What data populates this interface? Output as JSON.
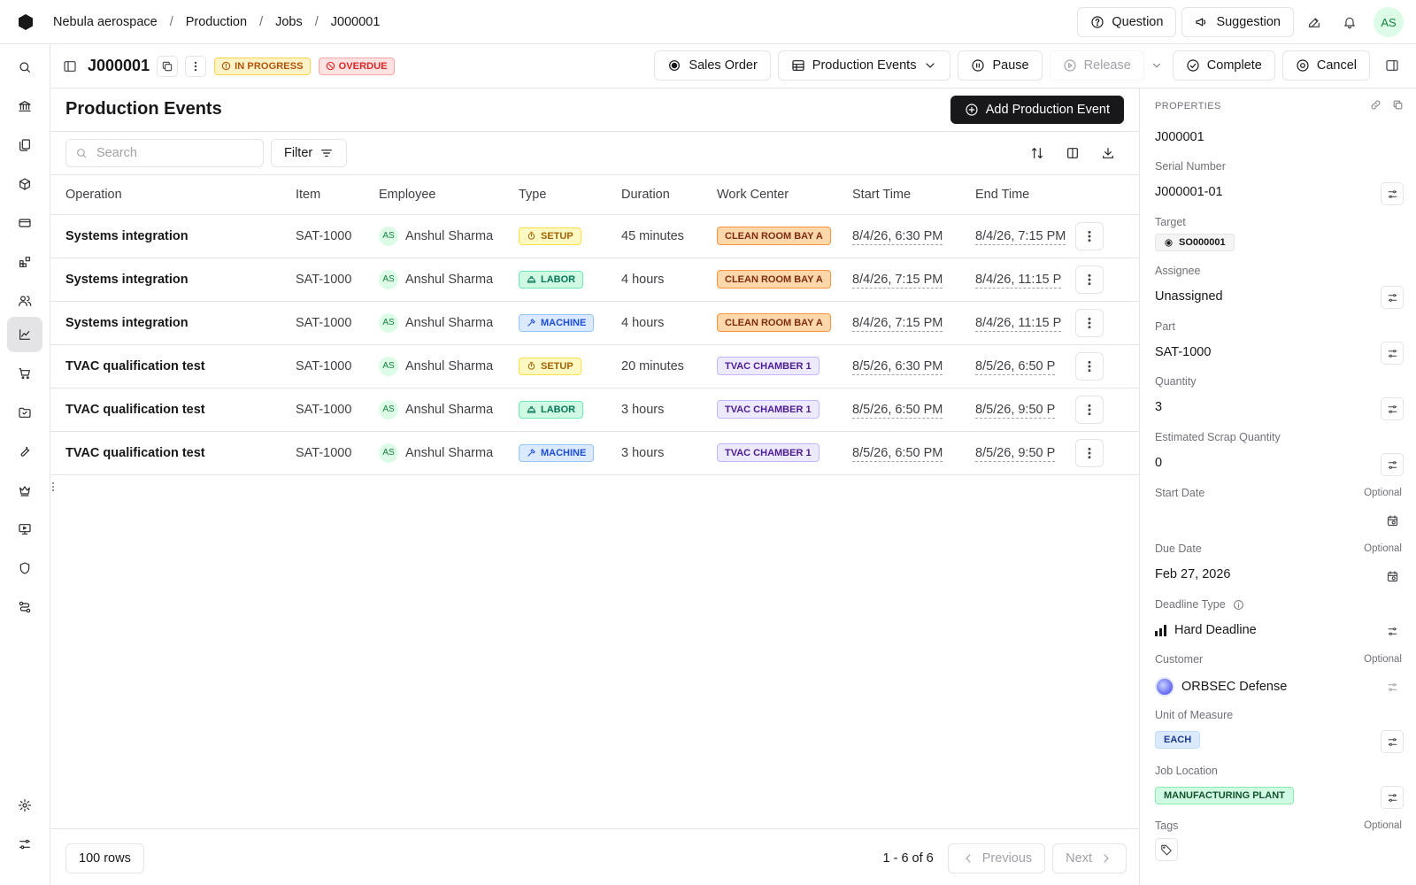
{
  "breadcrumbs": [
    "Nebula aerospace",
    "Production",
    "Jobs",
    "J000001"
  ],
  "top_actions": {
    "question": "Question",
    "suggestion": "Suggestion",
    "user_initials": "AS"
  },
  "job": {
    "id": "J000001",
    "status_badges": [
      {
        "label": "IN PROGRESS",
        "color": "#b45309"
      },
      {
        "label": "OVERDUE",
        "color": "#dc2626"
      }
    ],
    "actions": {
      "sales_order": "Sales Order",
      "production_events": "Production Events",
      "pause": "Pause",
      "release": "Release",
      "complete": "Complete",
      "cancel": "Cancel"
    }
  },
  "main": {
    "title": "Production Events",
    "add_button": "Add Production Event",
    "search_placeholder": "Search",
    "filter_label": "Filter",
    "columns": [
      "Operation",
      "Item",
      "Employee",
      "Type",
      "Duration",
      "Work Center",
      "Start Time",
      "End Time"
    ],
    "rows": [
      {
        "operation": "Systems integration",
        "item": "SAT-1000",
        "employee_initials": "AS",
        "employee": "Anshul Sharma",
        "type": "SETUP",
        "duration": "45 minutes",
        "work_center": "CLEAN ROOM BAY A",
        "start": "8/4/26, 6:30 PM",
        "end": "8/4/26, 7:15 PM"
      },
      {
        "operation": "Systems integration",
        "item": "SAT-1000",
        "employee_initials": "AS",
        "employee": "Anshul Sharma",
        "type": "LABOR",
        "duration": "4 hours",
        "work_center": "CLEAN ROOM BAY A",
        "start": "8/4/26, 7:15 PM",
        "end": "8/4/26, 11:15 P"
      },
      {
        "operation": "Systems integration",
        "item": "SAT-1000",
        "employee_initials": "AS",
        "employee": "Anshul Sharma",
        "type": "MACHINE",
        "duration": "4 hours",
        "work_center": "CLEAN ROOM BAY A",
        "start": "8/4/26, 7:15 PM",
        "end": "8/4/26, 11:15 P"
      },
      {
        "operation": "TVAC qualification test",
        "item": "SAT-1000",
        "employee_initials": "AS",
        "employee": "Anshul Sharma",
        "type": "SETUP",
        "duration": "20 minutes",
        "work_center": "TVAC CHAMBER 1",
        "start": "8/5/26, 6:30 PM",
        "end": "8/5/26, 6:50 P"
      },
      {
        "operation": "TVAC qualification test",
        "item": "SAT-1000",
        "employee_initials": "AS",
        "employee": "Anshul Sharma",
        "type": "LABOR",
        "duration": "3 hours",
        "work_center": "TVAC CHAMBER 1",
        "start": "8/5/26, 6:50 PM",
        "end": "8/5/26, 9:50 P"
      },
      {
        "operation": "TVAC qualification test",
        "item": "SAT-1000",
        "employee_initials": "AS",
        "employee": "Anshul Sharma",
        "type": "MACHINE",
        "duration": "3 hours",
        "work_center": "TVAC CHAMBER 1",
        "start": "8/5/26, 6:50 PM",
        "end": "8/5/26, 9:50 P"
      }
    ],
    "rows_per_page": "100 rows",
    "pagination_count": "1 - 6 of 6",
    "previous": "Previous",
    "next": "Next"
  },
  "properties": {
    "heading": "PROPERTIES",
    "job_id": "J000001",
    "serial_number_label": "Serial Number",
    "serial_number": "J000001-01",
    "target_label": "Target",
    "target": "SO000001",
    "assignee_label": "Assignee",
    "assignee": "Unassigned",
    "part_label": "Part",
    "part": "SAT-1000",
    "quantity_label": "Quantity",
    "quantity": "3",
    "scrap_label": "Estimated Scrap Quantity",
    "scrap": "0",
    "start_date_label": "Start Date",
    "optional": "Optional",
    "due_date_label": "Due Date",
    "due_date": "Feb 27, 2026",
    "deadline_type_label": "Deadline Type",
    "deadline_type": "Hard Deadline",
    "customer_label": "Customer",
    "customer": "ORBSEC Defense",
    "uom_label": "Unit of Measure",
    "uom": "EACH",
    "location_label": "Job Location",
    "location": "MANUFACTURING PLANT",
    "tags_label": "Tags"
  },
  "sidebar_icons": [
    "search-icon",
    "bank-icon",
    "documents-icon",
    "cube-icon",
    "card-icon",
    "blocks-icon",
    "users-icon",
    "chart-icon",
    "cart-icon",
    "inbox-icon",
    "wrench-icon",
    "crown-icon",
    "presentation-icon",
    "shield-icon",
    "route-icon",
    "gear-icon",
    "sliders-icon"
  ]
}
